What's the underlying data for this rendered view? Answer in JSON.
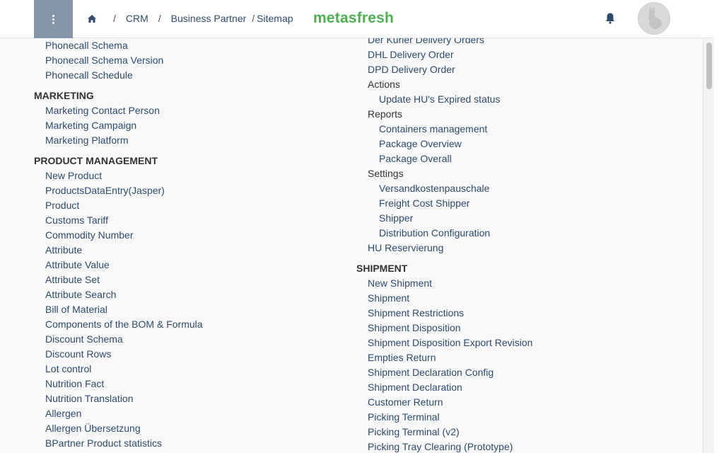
{
  "header": {
    "breadcrumb": {
      "sep1": "/",
      "crumb1": "CRM",
      "sep2": "/",
      "crumb2": "Business Partner",
      "sep3": "/",
      "crumb3": "Sitemap"
    },
    "logo": "metasfresh",
    "colors": {
      "menu_button": "#8696a8",
      "logo": "#4caf50",
      "link": "#2e4b6e"
    }
  },
  "left_column": [
    {
      "type": "link",
      "label": "Phonecall Schema"
    },
    {
      "type": "link",
      "label": "Phonecall Schema Version"
    },
    {
      "type": "link",
      "label": "Phonecall Schedule"
    },
    {
      "type": "section",
      "label": "MARKETING"
    },
    {
      "type": "link",
      "label": "Marketing Contact Person"
    },
    {
      "type": "link",
      "label": "Marketing Campaign"
    },
    {
      "type": "link",
      "label": "Marketing Platform"
    },
    {
      "type": "section",
      "label": "PRODUCT MANAGEMENT"
    },
    {
      "type": "link",
      "label": "New Product"
    },
    {
      "type": "link",
      "label": "ProductsDataEntry(Jasper)"
    },
    {
      "type": "link",
      "label": "Product"
    },
    {
      "type": "link",
      "label": "Customs Tariff"
    },
    {
      "type": "link",
      "label": "Commodity Number"
    },
    {
      "type": "link",
      "label": "Attribute"
    },
    {
      "type": "link",
      "label": "Attribute Value"
    },
    {
      "type": "link",
      "label": "Attribute Set"
    },
    {
      "type": "link",
      "label": "Attribute Search"
    },
    {
      "type": "link",
      "label": "Bill of Material"
    },
    {
      "type": "link",
      "label": "Components of the BOM & Formula"
    },
    {
      "type": "link",
      "label": "Discount Schema"
    },
    {
      "type": "link",
      "label": "Discount Rows"
    },
    {
      "type": "link",
      "label": "Lot control"
    },
    {
      "type": "link",
      "label": "Nutrition Fact"
    },
    {
      "type": "link",
      "label": "Nutrition Translation"
    },
    {
      "type": "link",
      "label": "Allergen"
    },
    {
      "type": "link",
      "label": "Allergen Übersetzung"
    },
    {
      "type": "link",
      "label": "BPartner Product statistics"
    }
  ],
  "right_column": [
    {
      "type": "link",
      "label": "Der Kurier Delivery Orders"
    },
    {
      "type": "link",
      "label": "DHL Delivery Order"
    },
    {
      "type": "link",
      "label": "DPD Delivery Order"
    },
    {
      "type": "group",
      "label": "Actions"
    },
    {
      "type": "sublink",
      "label": "Update HU's Expired status"
    },
    {
      "type": "group",
      "label": "Reports"
    },
    {
      "type": "sublink",
      "label": "Containers management"
    },
    {
      "type": "sublink",
      "label": "Package Overview"
    },
    {
      "type": "sublink",
      "label": "Package Overall"
    },
    {
      "type": "group",
      "label": "Settings"
    },
    {
      "type": "sublink",
      "label": "Versandkostenpauschale"
    },
    {
      "type": "sublink",
      "label": "Freight Cost Shipper"
    },
    {
      "type": "sublink",
      "label": "Shipper"
    },
    {
      "type": "sublink",
      "label": "Distribution Configuration"
    },
    {
      "type": "link",
      "label": "HU Reservierung"
    },
    {
      "type": "section",
      "label": "SHIPMENT"
    },
    {
      "type": "link",
      "label": "New Shipment"
    },
    {
      "type": "link",
      "label": "Shipment"
    },
    {
      "type": "link",
      "label": "Shipment Restrictions"
    },
    {
      "type": "link",
      "label": "Shipment Disposition"
    },
    {
      "type": "link",
      "label": "Shipment Disposition Export Revision"
    },
    {
      "type": "link",
      "label": "Empties Return"
    },
    {
      "type": "link",
      "label": "Shipment Declaration Config"
    },
    {
      "type": "link",
      "label": "Shipment Declaration"
    },
    {
      "type": "link",
      "label": "Customer Return"
    },
    {
      "type": "link",
      "label": "Picking Terminal"
    },
    {
      "type": "link",
      "label": "Picking Terminal (v2)"
    },
    {
      "type": "link",
      "label": "Picking Tray Clearing (Prototype)"
    }
  ]
}
